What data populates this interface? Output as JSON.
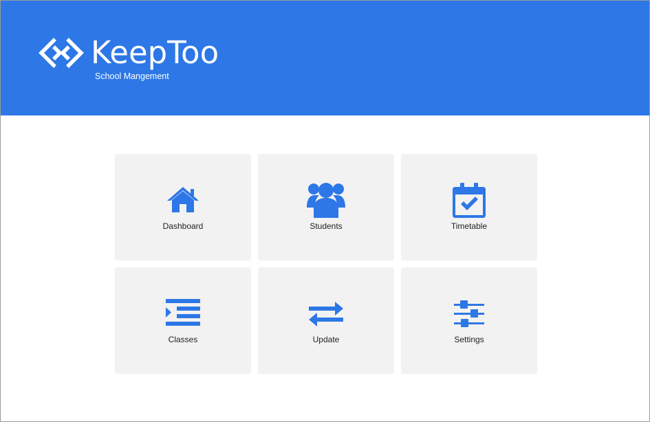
{
  "app": {
    "brand_name": "KeepToo",
    "subtitle": "School Mangement",
    "logo_icon": "keeptoo-logo-icon"
  },
  "colors": {
    "header_bg": "#2d77e6",
    "icon_blue": "#2d77e6",
    "tile_bg": "#f2f2f2",
    "text": "#222222"
  },
  "menu": {
    "items": [
      {
        "label": "Dashboard",
        "icon": "home-icon"
      },
      {
        "label": "Students",
        "icon": "users-icon"
      },
      {
        "label": "Timetable",
        "icon": "calendar-check-icon"
      },
      {
        "label": "Classes",
        "icon": "indent-list-icon"
      },
      {
        "label": "Update",
        "icon": "swap-arrows-icon"
      },
      {
        "label": "Settings",
        "icon": "sliders-icon"
      }
    ]
  }
}
